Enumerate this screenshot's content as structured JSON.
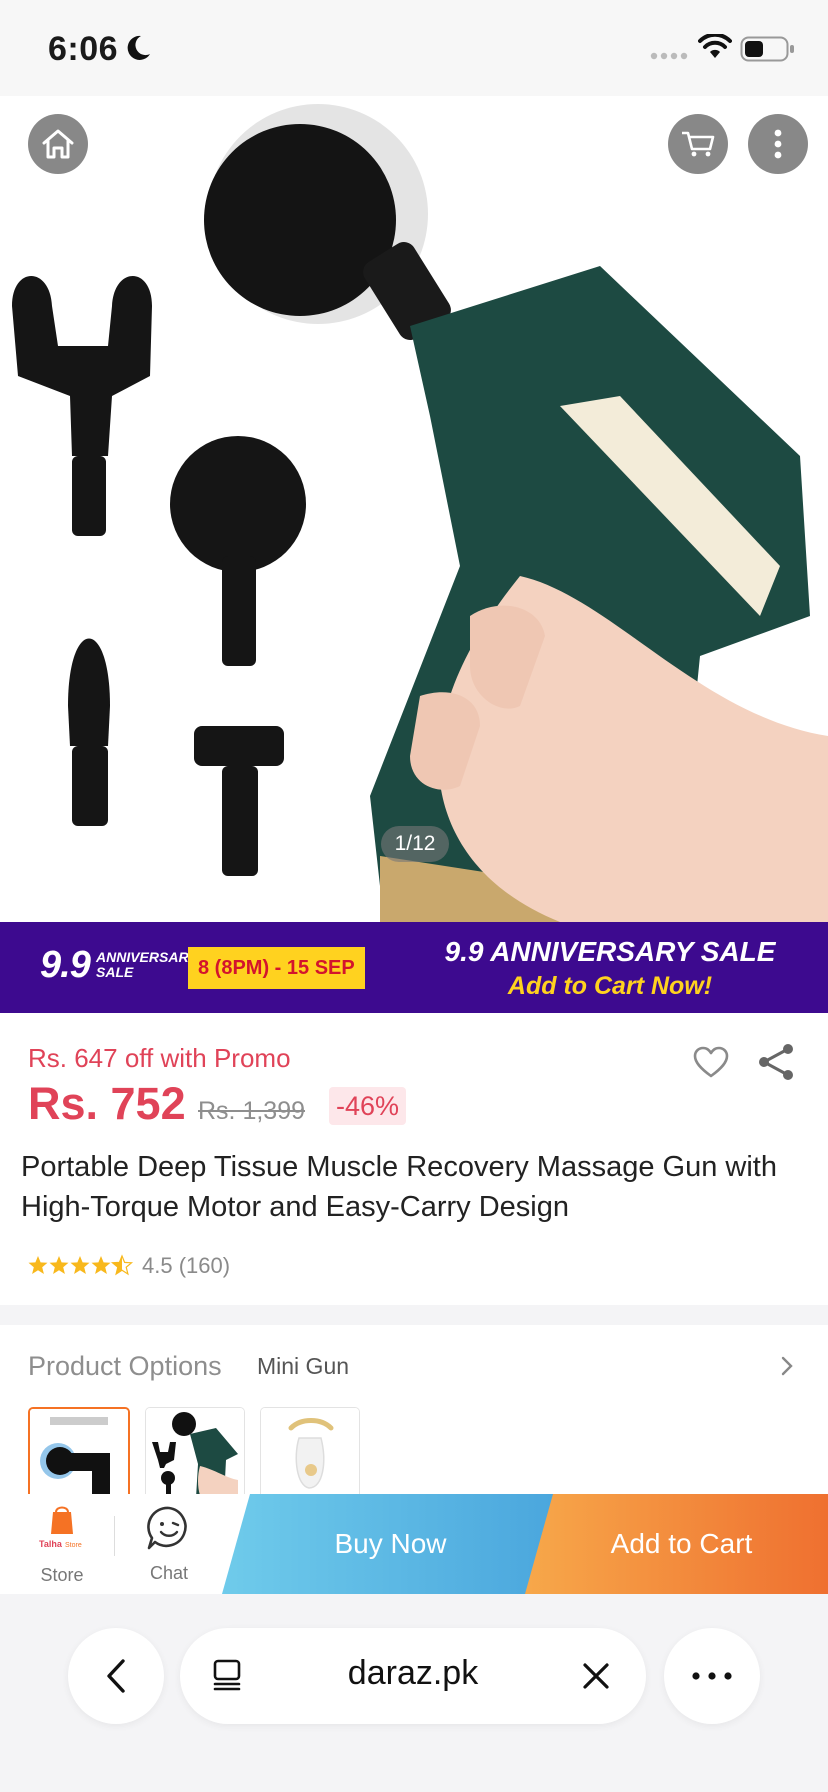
{
  "status_bar": {
    "time": "6:06"
  },
  "gallery": {
    "counter": "1/12"
  },
  "banner": {
    "logo": "9.9",
    "logo_sub": "ANNIVERSARY SALE",
    "date": "8 (8PM) - 15 SEP",
    "title": "9.9 ANNIVERSARY SALE",
    "cta": "Add to Cart Now!"
  },
  "product": {
    "promo": "Rs. 647 off with Promo",
    "price": "Rs. 752",
    "old_price": "Rs. 1,399",
    "discount": "-46%",
    "title": "Portable Deep Tissue Muscle Recovery Massage Gun with High-Torque Motor and Easy-Carry Design",
    "rating_text": "4.5  (160)",
    "rating": 4.5,
    "reviews": 160
  },
  "options": {
    "label": "Product Options",
    "value": "Mini Gun"
  },
  "actions": {
    "store_label": "Store",
    "chat_label": "Chat",
    "buy_now": "Buy Now",
    "add_to_cart": "Add to Cart"
  },
  "browser": {
    "url": "daraz.pk"
  },
  "colors": {
    "price": "#e04358",
    "brand_orange": "#f57224",
    "buy_now": "#4aa6dd",
    "banner": "#3d0a8f",
    "star": "#f8b81c"
  }
}
